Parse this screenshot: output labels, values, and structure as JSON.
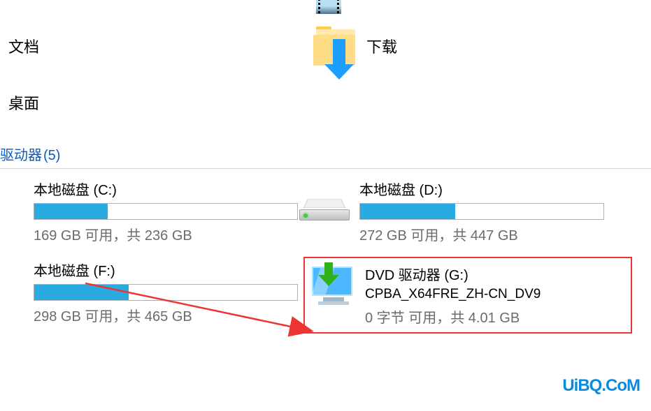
{
  "folders": {
    "documents": {
      "label": "文档"
    },
    "downloads": {
      "label": "下载"
    },
    "desktop": {
      "label": "桌面"
    }
  },
  "section": {
    "title": "驱动器",
    "count": "(5)"
  },
  "drives": {
    "c": {
      "name": "本地磁盘 (C:)",
      "status": "169 GB 可用，共 236 GB",
      "fill_percent": 28
    },
    "d": {
      "name": "本地磁盘 (D:)",
      "status": "272 GB 可用，共 447 GB",
      "fill_percent": 39
    },
    "f": {
      "name": "本地磁盘 (F:)",
      "status": "298 GB 可用，共 465 GB",
      "fill_percent": 36
    },
    "g": {
      "name": "DVD 驱动器 (G:)",
      "label": "CPBA_X64FRE_ZH-CN_DV9",
      "status": "0 字节 可用，共 4.01 GB"
    }
  },
  "watermark": "UiBQ.CoM"
}
